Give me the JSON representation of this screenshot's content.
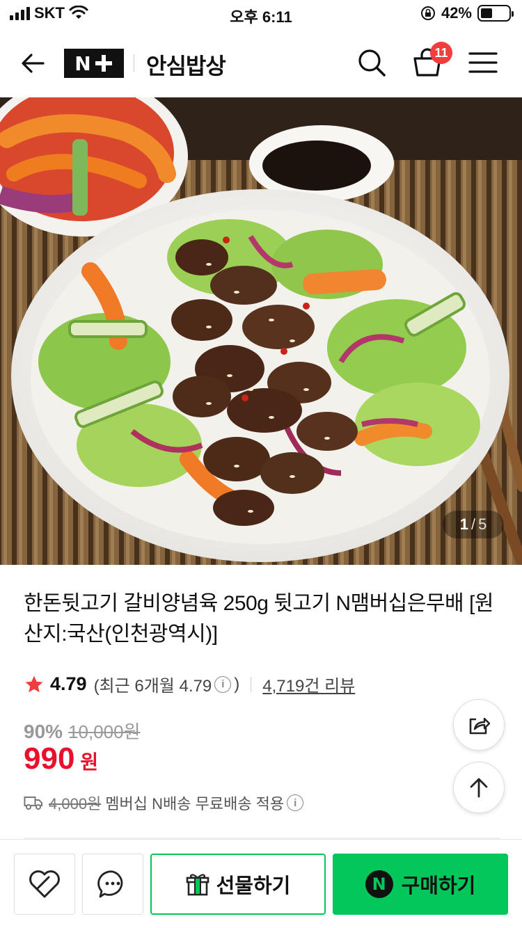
{
  "status_bar": {
    "carrier": "SKT",
    "time": "오후 6:11",
    "battery_percent": "42%",
    "battery_level": 0.42
  },
  "header": {
    "logo_text": "N",
    "store_name": "안심밥상",
    "cart_count": "11"
  },
  "product": {
    "image_counter_current": "1",
    "image_counter_total": "5",
    "image_counter_sep": "/",
    "title": "한돈뒷고기 갈비양념육 250g 뒷고기 N맴버십은무배 [원산지:국산(인천광역시)]",
    "rating": "4.79",
    "recent_rating_prefix": "(최근 6개월 4.79",
    "recent_rating_suffix": ")",
    "review_count": "4,719건 리뷰",
    "discount_rate": "90%",
    "original_price": "10,000원",
    "sale_price": "990",
    "sale_unit": "원",
    "shipping_old_fee": "4,000원",
    "shipping_text": "멤버십 N배송 무료배송 적용"
  },
  "bottom_bar": {
    "gift_label": "선물하기",
    "buy_label": "구매하기",
    "npay_mark": "N"
  },
  "colors": {
    "accent_green": "#03c75a",
    "sale_red": "#e8112d",
    "badge_red": "#f03e3e"
  },
  "icons": [
    "back-arrow-icon",
    "search-icon",
    "shopping-bag-icon",
    "menu-icon",
    "star-icon",
    "info-icon",
    "truck-icon",
    "share-icon",
    "arrow-up-icon",
    "heart-icon",
    "chat-icon",
    "gift-icon"
  ]
}
